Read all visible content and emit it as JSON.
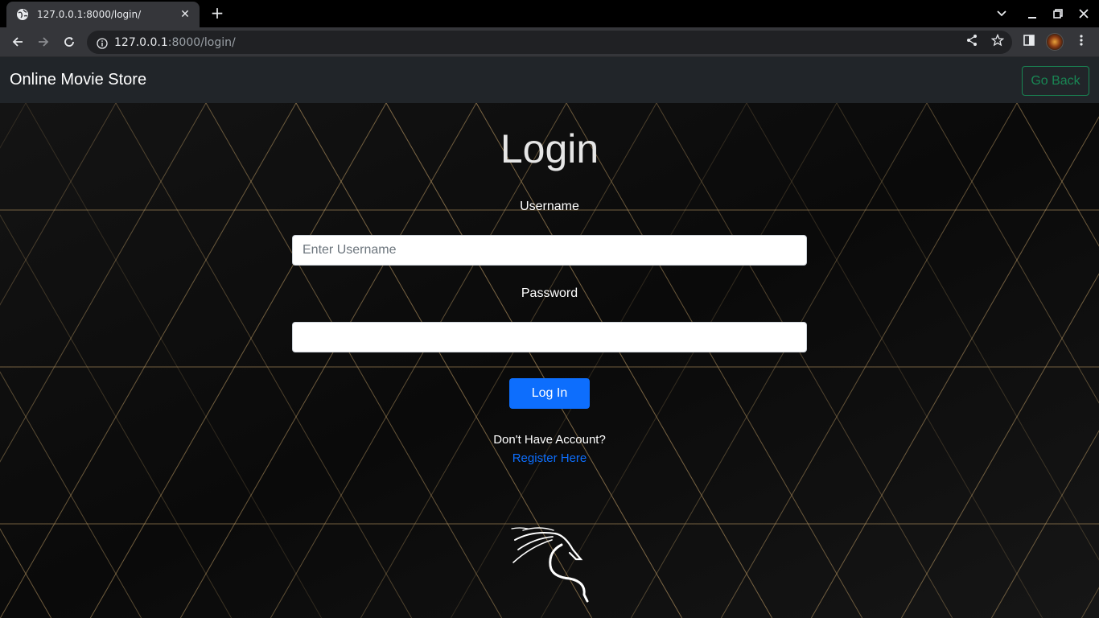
{
  "browser": {
    "tab_title": "127.0.0.1:8000/login/",
    "url_host": "127.0.0.1",
    "url_rest": ":8000/login/"
  },
  "navbar": {
    "brand": "Online Movie Store",
    "go_back_label": "Go Back"
  },
  "login_form": {
    "title": "Login",
    "username_label": "Username",
    "username_placeholder": "Enter Username",
    "username_value": "",
    "password_label": "Password",
    "password_value": "",
    "submit_label": "Log In",
    "no_account_text": "Don't Have Account?",
    "register_link": "Register Here"
  },
  "colors": {
    "navbar_bg": "#212529",
    "go_back": "#198754",
    "primary": "#0d6efd",
    "pattern_line": "#c8a46a"
  },
  "icons": [
    "globe-icon",
    "close-icon",
    "plus-icon",
    "back-arrow-icon",
    "forward-arrow-icon",
    "reload-icon",
    "info-icon",
    "share-icon",
    "star-icon",
    "sidepanel-icon",
    "kebab-menu-icon",
    "minimize-icon",
    "restore-icon",
    "chevron-down-icon",
    "dragon-logo-icon"
  ]
}
